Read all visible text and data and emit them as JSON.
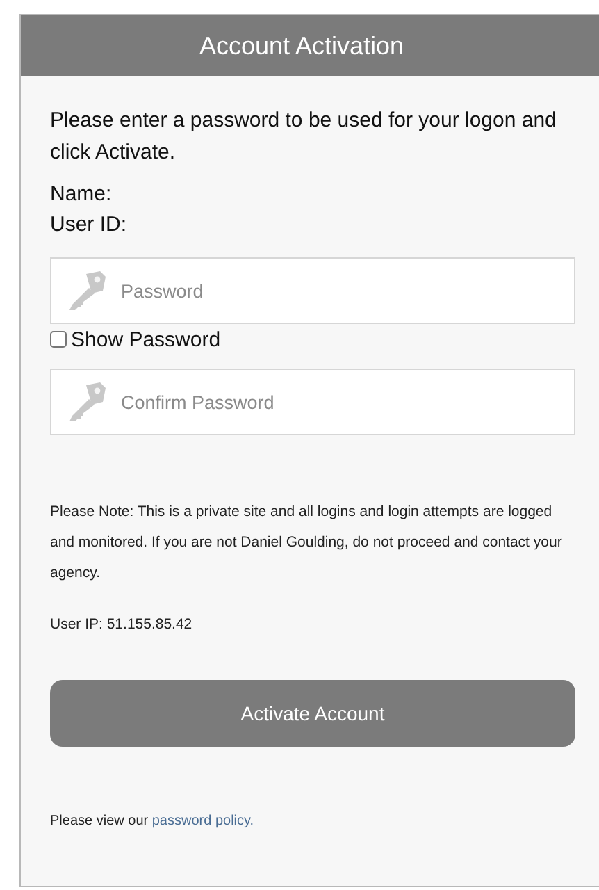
{
  "header": {
    "title": "Account Activation"
  },
  "intro": "Please enter a password to be used for your logon and click Activate.",
  "details": [
    "Name:",
    "User ID:"
  ],
  "password_field": {
    "placeholder": "Password"
  },
  "show_password": {
    "label": "Show Password",
    "checked": false
  },
  "confirm_field": {
    "placeholder": "Confirm Password"
  },
  "note": "Please Note: This is a private site and all logins and login attempts are logged and monitored. If you are not Daniel Goulding, do not proceed and contact your agency.",
  "user_ip": "User IP: 51.155.85.42",
  "activate_button": "Activate Account",
  "policy": {
    "text": "Please view our ",
    "link": "password policy."
  }
}
